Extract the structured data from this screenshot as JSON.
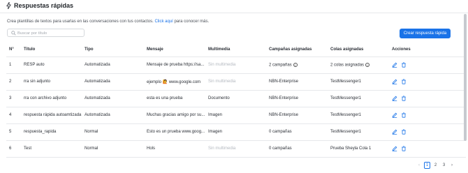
{
  "header": {
    "title": "Respuestas rápidas",
    "icon": "bolt-icon"
  },
  "description": {
    "text": "Crea plantillas de textos para usarlas en las conversaciones con tus contactos.",
    "link": "Click aquí",
    "suffix": "para conocer más."
  },
  "search": {
    "placeholder": "Buscar por título",
    "value": ""
  },
  "create_button": "Crear respuesta rápida",
  "table": {
    "columns": [
      "N°",
      "Título",
      "Tipo",
      "Mensaje",
      "Multimedia",
      "Campañas asignadas",
      "Colas asignadas",
      "Acciones"
    ],
    "rows": [
      {
        "n": "1",
        "titulo": "RESP auto",
        "tipo": "Automatizada",
        "mensaje": "Mensaje de prueba https://sa...",
        "multimedia": "Sin multimedia",
        "campanas": "2 campañas",
        "campanas_info": true,
        "colas": "2 colas asignadas",
        "colas_info": true
      },
      {
        "n": "2",
        "titulo": "rra sin adjunto",
        "tipo": "Automatizada",
        "mensaje": "ejemplo 🙋 www.google.com",
        "multimedia": "Sin multimedia",
        "campanas": "NBN-Enterprise",
        "campanas_info": false,
        "colas": "TestMessenger1",
        "colas_info": false
      },
      {
        "n": "3",
        "titulo": "rra con archivo adjunto",
        "tipo": "Automatizada",
        "mensaje": "esta es una prueba",
        "multimedia": "Documento",
        "campanas": "NBN-Enterprise",
        "campanas_info": false,
        "colas": "TestMessenger1",
        "colas_info": false
      },
      {
        "n": "4",
        "titulo": "respuesta rápida autoamtizada",
        "tipo": "Automatizada",
        "mensaje": "Muchas gracias amigo por su...",
        "multimedia": "Imagen",
        "campanas": "NBN-Enterprise",
        "campanas_info": false,
        "colas": "TestMessenger1",
        "colas_info": false
      },
      {
        "n": "5",
        "titulo": "respuesta_rapida",
        "tipo": "Normal",
        "mensaje": "Esto es un prueba www.goog...",
        "multimedia": "Imagen",
        "campanas": "0 campañas",
        "campanas_info": false,
        "colas": "TestMessenger1",
        "colas_info": false
      },
      {
        "n": "6",
        "titulo": "Test",
        "tipo": "Normal",
        "mensaje": "Hols",
        "multimedia": "Sin multimedia",
        "campanas": "0 campañas",
        "campanas_info": false,
        "colas": "Prueba Sheyla Cola 1",
        "colas_info": false
      }
    ]
  },
  "pagination": {
    "pages": [
      "1",
      "2",
      "3"
    ],
    "current": "1"
  },
  "colors": {
    "accent": "#1a73e8",
    "muted": "#b4b9c0",
    "border": "#e6e8eb"
  }
}
